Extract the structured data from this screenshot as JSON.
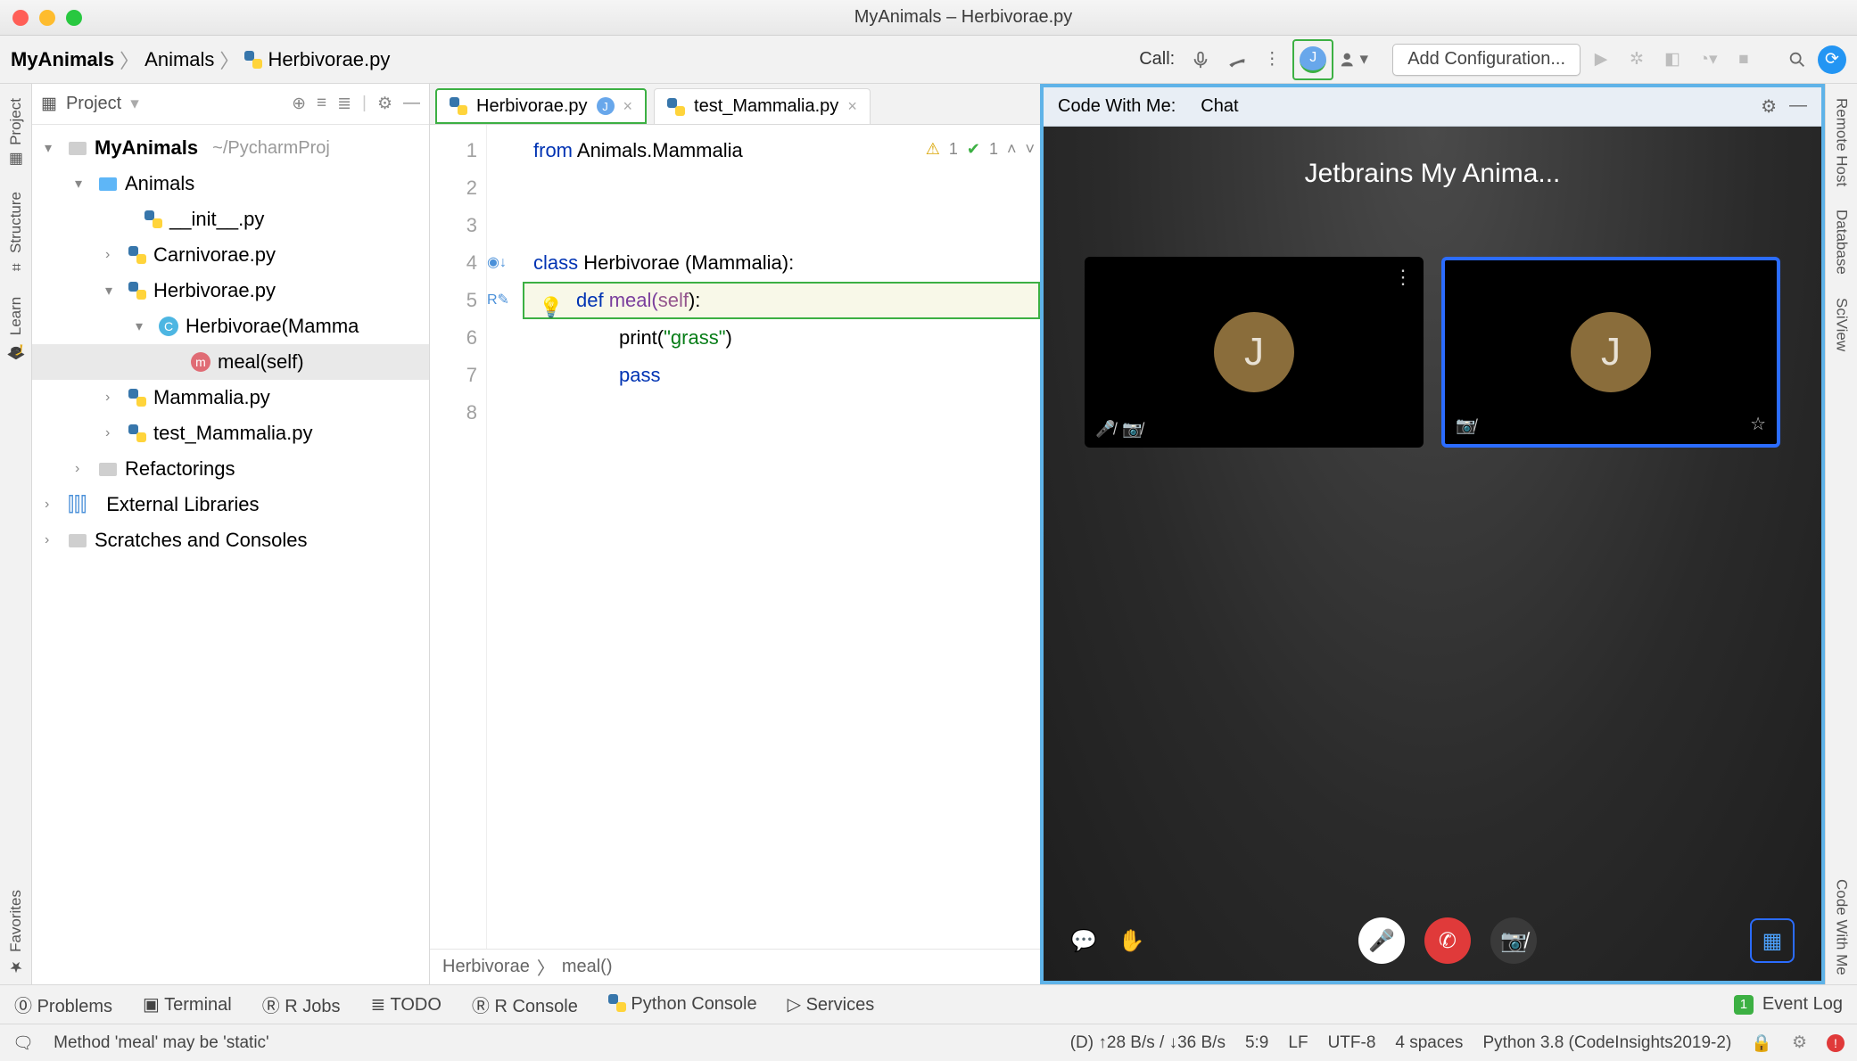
{
  "window": {
    "title": "MyAnimals – Herbivorae.py"
  },
  "breadcrumbs": {
    "a": "MyAnimals",
    "b": "Animals",
    "c": "Herbivorae.py"
  },
  "toolbar": {
    "call_label": "Call:",
    "avatar_letter": "J",
    "add_config": "Add Configuration..."
  },
  "leftrail": {
    "project": "Project",
    "structure": "Structure",
    "learn": "Learn",
    "favorites": "Favorites"
  },
  "rightrail": {
    "remote": "Remote Host",
    "database": "Database",
    "sciview": "SciView",
    "cwm": "Code With Me"
  },
  "tree": {
    "header": "Project",
    "root": "MyAnimals",
    "root_path": "~/PycharmProj",
    "animals": "Animals",
    "init": "__init__.py",
    "carn": "Carnivorae.py",
    "herb": "Herbivorae.py",
    "herb_class": "Herbivorae(Mamma",
    "herb_meal": "meal(self)",
    "mamm": "Mammalia.py",
    "test": "test_Mammalia.py",
    "refact": "Refactorings",
    "extlib": "External Libraries",
    "scratch": "Scratches and Consoles"
  },
  "tabs": {
    "t1": "Herbivorae.py",
    "t1_dot": "J",
    "t2": "test_Mammalia.py"
  },
  "code": {
    "l1a": "from",
    "l1b": " Animals.Mammalia ",
    "l4a": "class",
    "l4b": " Herbivorae (Mammalia):",
    "l5a": "def",
    "l5b": " meal(",
    "l5c": "self",
    "l5d": "):",
    "l6a": "print(",
    "l6b": "\"grass\"",
    "l6c": ")",
    "l7a": "pass",
    "lines": [
      "1",
      "2",
      "3",
      "4",
      "5",
      "6",
      "7",
      "8"
    ],
    "insp_warn": "1",
    "insp_ok": "1"
  },
  "editor_crumbs": {
    "a": "Herbivorae",
    "b": "meal()"
  },
  "cwm": {
    "tab_cwm": "Code With Me:",
    "tab_chat": "Chat",
    "title": "Jetbrains My Anima...",
    "avatar": "J"
  },
  "bottom": {
    "problems": "Problems",
    "terminal": "Terminal",
    "rjobs": "R Jobs",
    "todo": "TODO",
    "rconsole": "R Console",
    "pyconsole": "Python Console",
    "services": "Services",
    "eventlog": "Event Log",
    "evcount": "1"
  },
  "status": {
    "hint": "Method 'meal' may be 'static'",
    "net": "(D)  ↑28 B/s / ↓36 B/s",
    "pos": "5:9",
    "lf": "LF",
    "enc": "UTF-8",
    "indent": "4 spaces",
    "sdk": "Python 3.8 (CodeInsights2019-2)"
  }
}
